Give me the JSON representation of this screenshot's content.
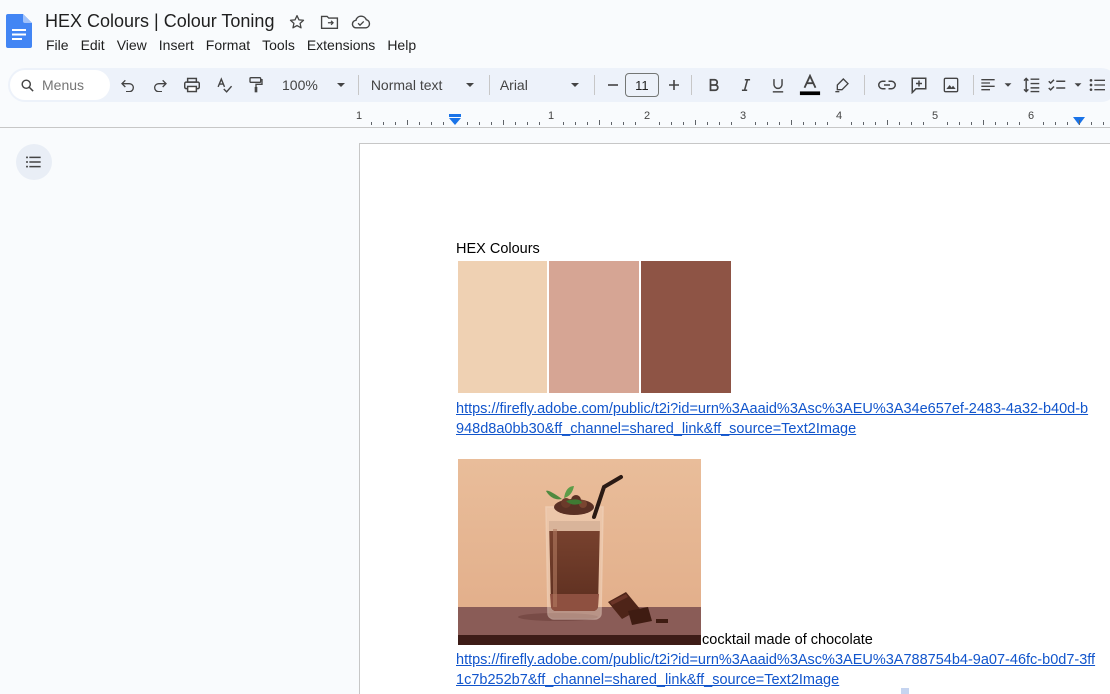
{
  "document": {
    "title": "HEX Colours | Colour Toning"
  },
  "menu": [
    "File",
    "Edit",
    "View",
    "Insert",
    "Format",
    "Tools",
    "Extensions",
    "Help"
  ],
  "toolbar": {
    "search_placeholder": "Menus",
    "zoom": "100%",
    "style": "Normal text",
    "font": "Arial",
    "font_size": "11"
  },
  "ruler": {
    "labels": [
      "1",
      "1",
      "2",
      "3",
      "4",
      "5",
      "6"
    ]
  },
  "content": {
    "heading": "HEX Colours",
    "swatches": [
      "#efd1b3",
      "#d6a594",
      "#8e5445"
    ],
    "link1": "https://firefly.adobe.com/public/t2i?id=urn%3Aaaid%3Asc%3AEU%3A34e657ef-2483-4a32-b40d-b948d8a0bb30&ff_channel=shared_link&ff_source=Text2Image",
    "caption": "cocktail made of chocolate",
    "link2": "https://firefly.adobe.com/public/t2i?id=urn%3Aaaid%3Asc%3AEU%3A788754b4-9a07-46fc-b0d7-3ff1c7b252b7&ff_channel=shared_link&ff_source=Text2Image"
  },
  "colors": {
    "accent": "#1a73e8",
    "link": "#1155cc",
    "toolbar_bg": "#edf2fa"
  }
}
